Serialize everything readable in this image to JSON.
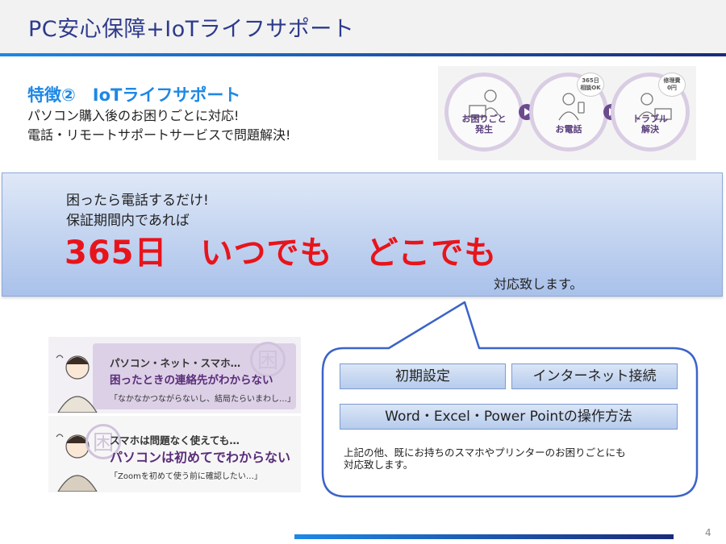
{
  "slide": {
    "title": "PC安心保障+IoTライフサポート",
    "page_number": "4"
  },
  "feature": {
    "heading": "特徴②　IoTライフサポート",
    "line1": "パソコン購入後のお困りごとに対応!",
    "line2": "電話・リモートサポートサービスで問題解決!"
  },
  "flow": {
    "steps": [
      {
        "label1": "お困りごと",
        "label2": "発生"
      },
      {
        "label1": "お電話",
        "label2": ""
      },
      {
        "label1": "トラブル",
        "label2": "解決"
      }
    ],
    "badge_phone": {
      "line1": "365日",
      "line2": "相談OK"
    },
    "badge_fee": {
      "line1": "修理費",
      "line2": "0円"
    }
  },
  "banner": {
    "line1": "困ったら電話するだけ!",
    "line2": "保証期間内であれば",
    "headline": "365日　いつでも　どこでも",
    "tail": "対応致します。"
  },
  "support": {
    "buttons": {
      "initial_setup": "初期設定",
      "internet": "インターネット接続",
      "office": "Word・Excel・Power Pointの操作方法"
    },
    "note_line1": "上記の他、既にお持ちのスマホやプリンターのお困りごとにも",
    "note_line2": "対応致します。"
  },
  "cards": [
    {
      "line1": "パソコン・ネット・スマホ…",
      "line2": "困ったときの連絡先がわからない",
      "line3": "「なかなかつながらないし、結局たらいまわし…」",
      "watermark": "困"
    },
    {
      "line1": "スマホは問題なく使えても…",
      "line2": "パソコンは初めてでわからない",
      "line3": "「Zoomを初めて使う前に確認したい…」",
      "watermark": "困"
    }
  ],
  "colors": {
    "title": "#2d3a8c",
    "accent_blue": "#1e88e5",
    "headline_red": "#e8141b",
    "flow_purple": "#6b4a8e"
  }
}
